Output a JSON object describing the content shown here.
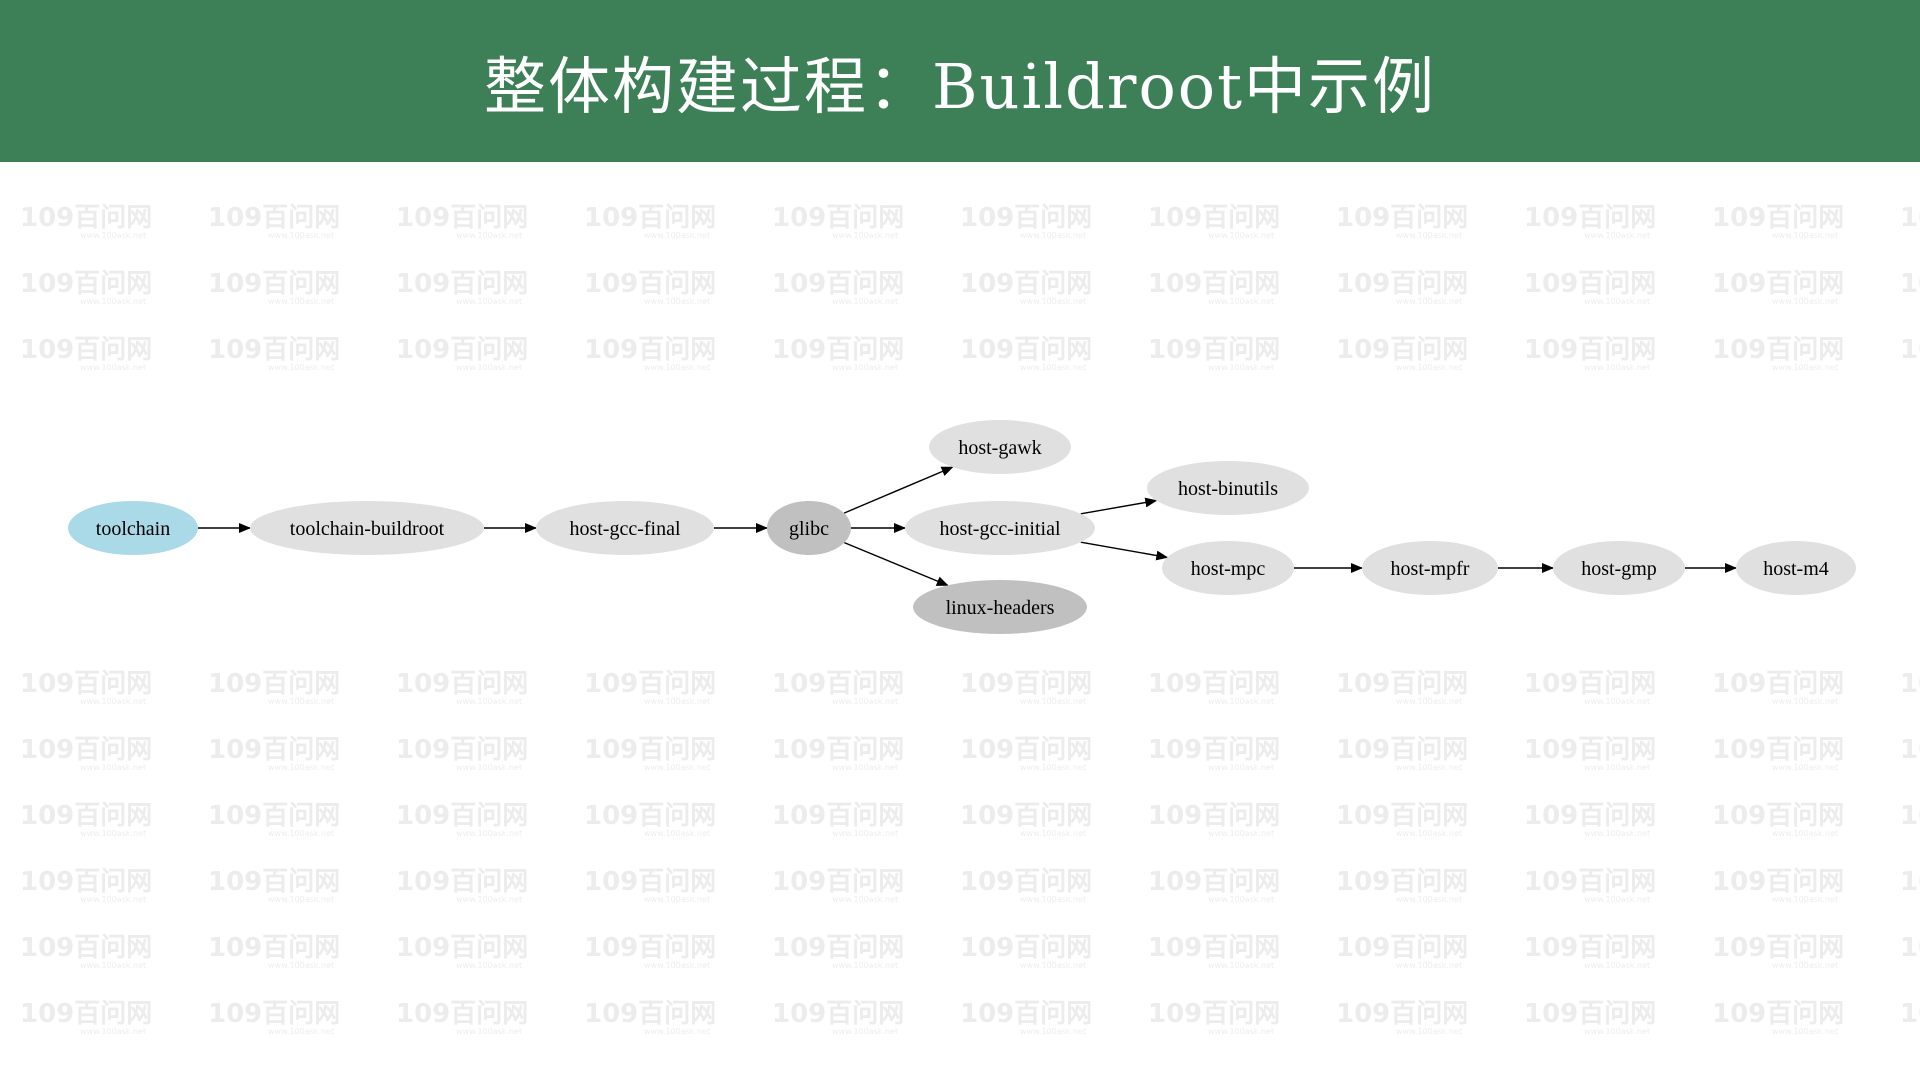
{
  "header": {
    "title": "整体构建过程：Buildroot中示例",
    "background_color": "#3d8058"
  },
  "watermark": {
    "brand": "109百问网",
    "url": "www.100ask.net"
  },
  "diagram": {
    "nodes": [
      {
        "id": "toolchain",
        "label": "toolchain",
        "color": "#aad9e8"
      },
      {
        "id": "toolchain-buildroot",
        "label": "toolchain-buildroot",
        "color": "#e0e0e0"
      },
      {
        "id": "host-gcc-final",
        "label": "host-gcc-final",
        "color": "#e0e0e0"
      },
      {
        "id": "glibc",
        "label": "glibc",
        "color": "#c0c0c0"
      },
      {
        "id": "host-gawk",
        "label": "host-gawk",
        "color": "#e0e0e0"
      },
      {
        "id": "host-gcc-initial",
        "label": "host-gcc-initial",
        "color": "#e0e0e0"
      },
      {
        "id": "linux-headers",
        "label": "linux-headers",
        "color": "#c0c0c0"
      },
      {
        "id": "host-binutils",
        "label": "host-binutils",
        "color": "#e0e0e0"
      },
      {
        "id": "host-mpc",
        "label": "host-mpc",
        "color": "#e0e0e0"
      },
      {
        "id": "host-mpfr",
        "label": "host-mpfr",
        "color": "#e0e0e0"
      },
      {
        "id": "host-gmp",
        "label": "host-gmp",
        "color": "#e0e0e0"
      },
      {
        "id": "host-m4",
        "label": "host-m4",
        "color": "#e0e0e0"
      }
    ],
    "edges": [
      {
        "from": "toolchain",
        "to": "toolchain-buildroot"
      },
      {
        "from": "toolchain-buildroot",
        "to": "host-gcc-final"
      },
      {
        "from": "host-gcc-final",
        "to": "glibc"
      },
      {
        "from": "glibc",
        "to": "host-gawk"
      },
      {
        "from": "glibc",
        "to": "host-gcc-initial"
      },
      {
        "from": "glibc",
        "to": "linux-headers"
      },
      {
        "from": "host-gcc-initial",
        "to": "host-binutils"
      },
      {
        "from": "host-gcc-initial",
        "to": "host-mpc"
      },
      {
        "from": "host-mpc",
        "to": "host-mpfr"
      },
      {
        "from": "host-mpfr",
        "to": "host-gmp"
      },
      {
        "from": "host-gmp",
        "to": "host-m4"
      }
    ]
  }
}
